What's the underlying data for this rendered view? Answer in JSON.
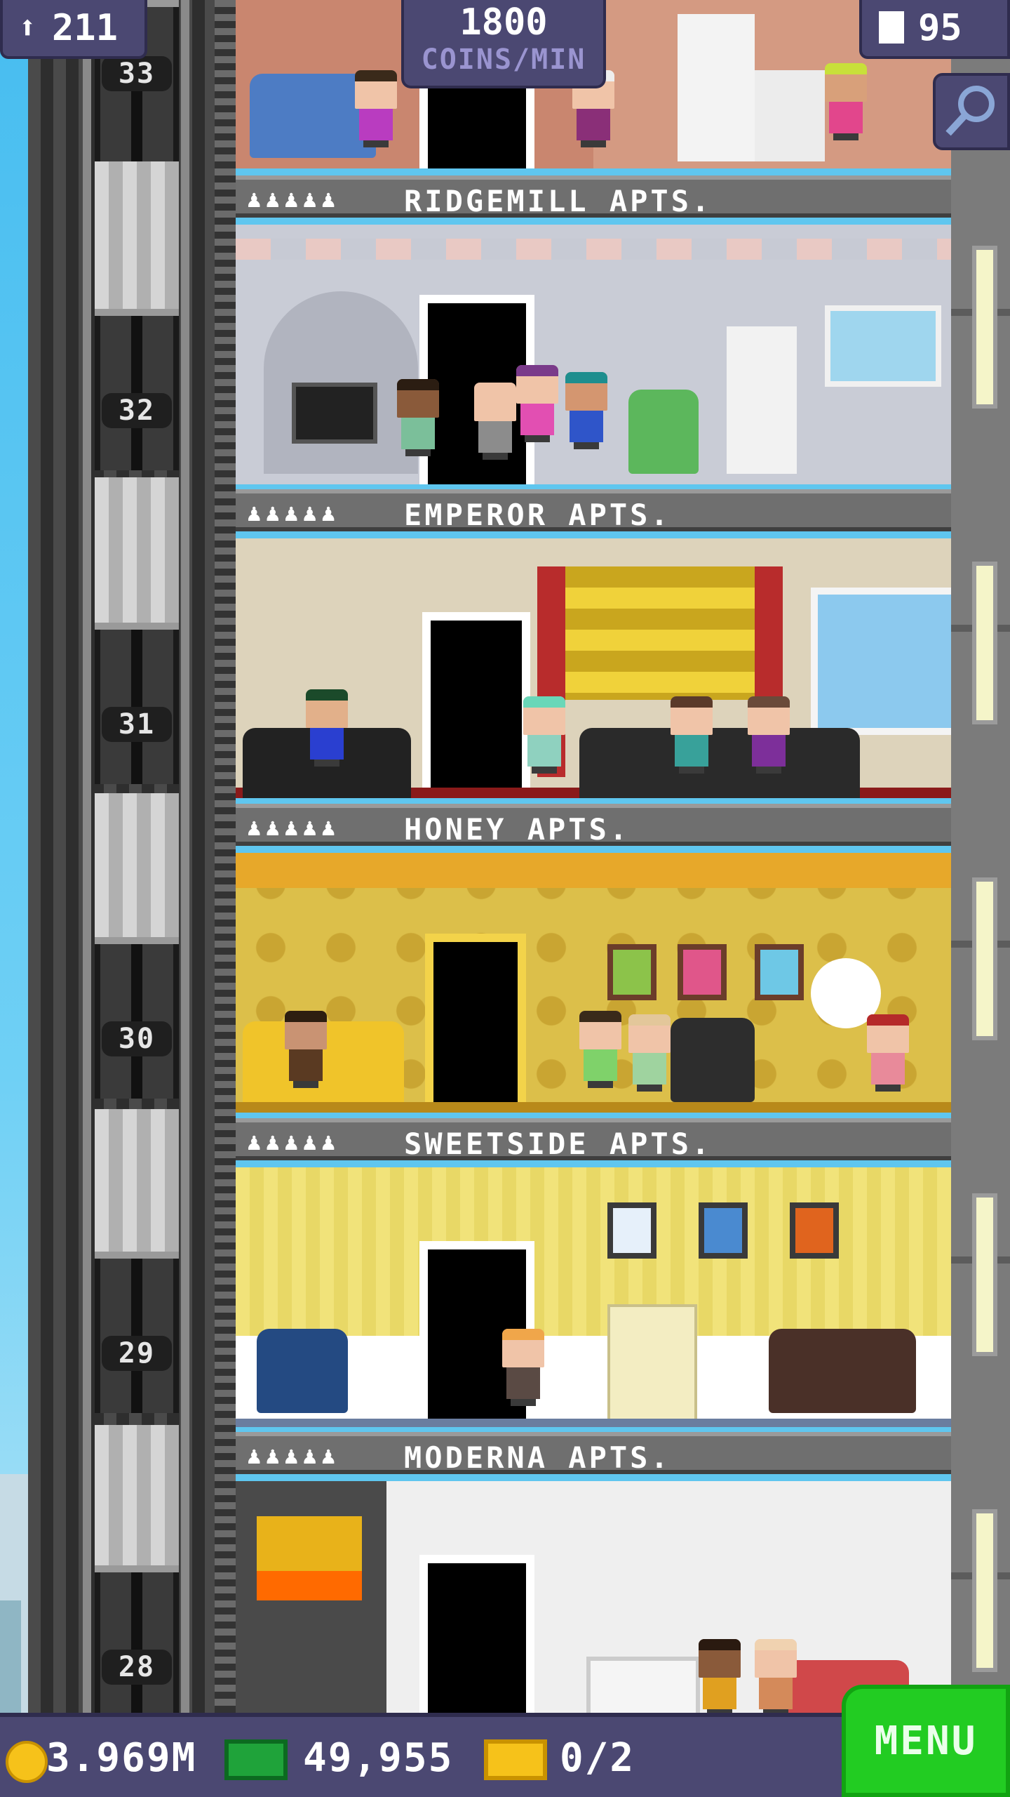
{
  "hud": {
    "population": "211",
    "coins_rate_value": "1800",
    "coins_rate_unit": "COINS/MIN",
    "floors": "95"
  },
  "elevator": {
    "floor_numbers": [
      "33",
      "32",
      "31",
      "30",
      "29",
      "28"
    ]
  },
  "floors": [
    {
      "name": "RIDGEMILL APTS.",
      "residents_icons": "♟♟♟♟♟"
    },
    {
      "name": "EMPEROR APTS.",
      "residents_icons": "♟♟♟♟♟"
    },
    {
      "name": "HONEY APTS.",
      "residents_icons": "♟♟♟♟♟"
    },
    {
      "name": "SWEETSIDE APTS.",
      "residents_icons": "♟♟♟♟♟"
    },
    {
      "name": "MODERNA APTS.",
      "residents_icons": "♟♟♟♟♟"
    }
  ],
  "bottom_bar": {
    "coins": "3.969M",
    "bux": "49,955",
    "tickets": "0/2",
    "menu_label": "MENU"
  },
  "colors": {
    "hud_bg": "#4b4872",
    "menu_green": "#22cc22",
    "sky": "#5fc6ef"
  },
  "icons": [
    "person-icon",
    "building-icon",
    "search-icon",
    "coin-icon",
    "bux-icon",
    "ticket-icon"
  ]
}
